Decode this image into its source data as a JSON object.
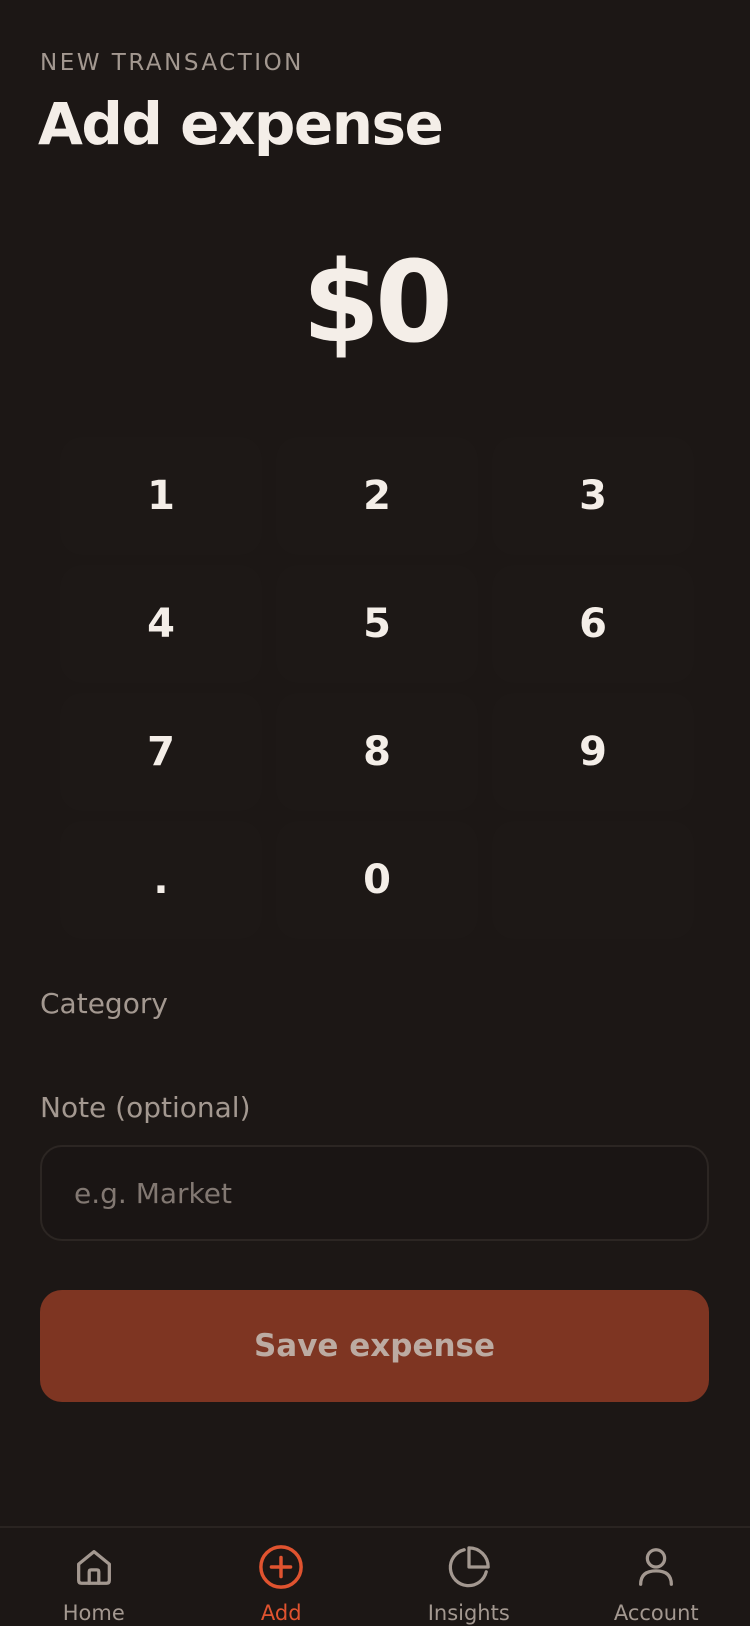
{
  "header": {
    "eyebrow": "NEW TRANSACTION",
    "title": "Add expense"
  },
  "amount": {
    "display": "$0"
  },
  "keypad": {
    "keys": [
      "1",
      "2",
      "3",
      "4",
      "5",
      "6",
      "7",
      "8",
      "9",
      ".",
      "0",
      ""
    ]
  },
  "form": {
    "category_label": "Category",
    "note_label": "Note (optional)",
    "note_value": "",
    "note_placeholder": "e.g. Market",
    "save_label": "Save expense"
  },
  "tabbar": {
    "active": "Add",
    "tabs": [
      {
        "label": "Home",
        "icon": "home-icon"
      },
      {
        "label": "Add",
        "icon": "plus-circle-icon"
      },
      {
        "label": "Insights",
        "icon": "pie-chart-icon"
      },
      {
        "label": "Account",
        "icon": "user-icon"
      }
    ]
  },
  "colors": {
    "background": "#1c1715",
    "accent": "#e0532f",
    "save_button_disabled": "#7e3522",
    "muted_text": "#a39890"
  }
}
